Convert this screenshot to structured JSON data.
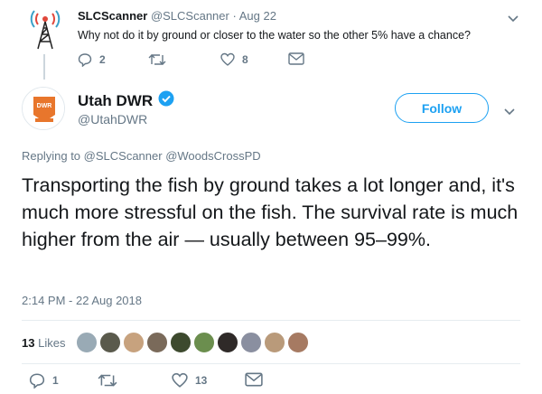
{
  "parent_tweet": {
    "name": "SLCScanner",
    "handle": "@SLCScanner",
    "separator": "·",
    "date": "Aug 22",
    "text": "Why not do it by ground or closer to the water so the other 5% have a chance?",
    "reply_count": "2",
    "retweet_count": "",
    "like_count": "8"
  },
  "main_tweet": {
    "name": "Utah DWR",
    "handle": "@UtahDWR",
    "avatar_text": "DWR",
    "follow_label": "Follow",
    "replying_prefix": "Replying to",
    "replying_to_1": "@SLCScanner",
    "replying_to_2": "@WoodsCrossPD",
    "text": "Transporting the fish by ground takes a lot longer and, it's much more stressful on the fish. The survival rate is much higher from the air — usually between 95–99%.",
    "timestamp": "2:14 PM - 22 Aug 2018",
    "likes_number": "13",
    "likes_word": "Likes",
    "reply_count": "1",
    "retweet_count": "",
    "like_count": "13"
  },
  "colors": {
    "accent": "#1da1f2",
    "muted": "#657786",
    "verified": "#1da1f2",
    "avatar_orange": "#e8762c"
  },
  "icons": [
    "broadcast-tower-icon",
    "chevron-down-icon",
    "reply-icon",
    "retweet-icon",
    "heart-icon",
    "message-icon",
    "verified-icon"
  ]
}
